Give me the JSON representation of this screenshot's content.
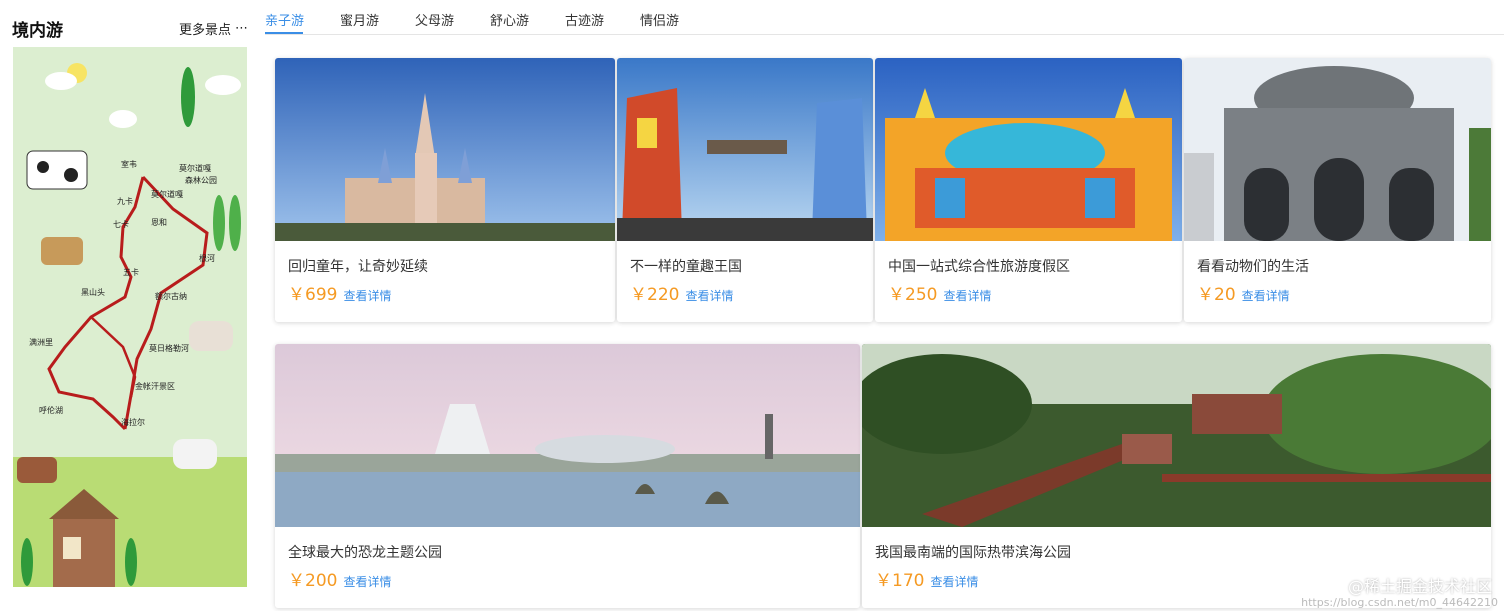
{
  "sidebar": {
    "title": "境内游",
    "more_label": "更多景点",
    "more_icon": "ellipsis-icon",
    "map_labels": [
      "室韦",
      "莫尔道嘎",
      "森林公园",
      "九卡",
      "莫尔道嘎",
      "七卡",
      "恩和",
      "根河",
      "五卡",
      "黑山头",
      "额尔古纳",
      "满洲里",
      "莫日格勒河",
      "金帐汗景区",
      "呼伦湖",
      "海拉尔"
    ]
  },
  "tabs": [
    {
      "label": "亲子游",
      "active": true
    },
    {
      "label": "蜜月游",
      "active": false
    },
    {
      "label": "父母游",
      "active": false
    },
    {
      "label": "舒心游",
      "active": false
    },
    {
      "label": "古迹游",
      "active": false
    },
    {
      "label": "情侣游",
      "active": false
    }
  ],
  "cards": [
    {
      "title": "回归童年，让奇妙延续",
      "price": "￥699",
      "detail": "查看详情"
    },
    {
      "title": "不一样的童趣王国",
      "price": "￥220",
      "detail": "查看详情"
    },
    {
      "title": "中国一站式综合性旅游度假区",
      "price": "￥250",
      "detail": "查看详情"
    },
    {
      "title": "看看动物们的生活",
      "price": "￥20",
      "detail": "查看详情"
    },
    {
      "title": "全球最大的恐龙主题公园",
      "price": "￥200",
      "detail": "查看详情"
    },
    {
      "title": "我国最南端的国际热带滨海公园",
      "price": "￥170",
      "detail": "查看详情"
    }
  ],
  "watermark": {
    "text": "@稀土掘金技术社区",
    "url": "https://blog.csdn.net/m0_44642210"
  },
  "colors": {
    "accent": "#3a8ee6",
    "price": "#f59a23"
  }
}
